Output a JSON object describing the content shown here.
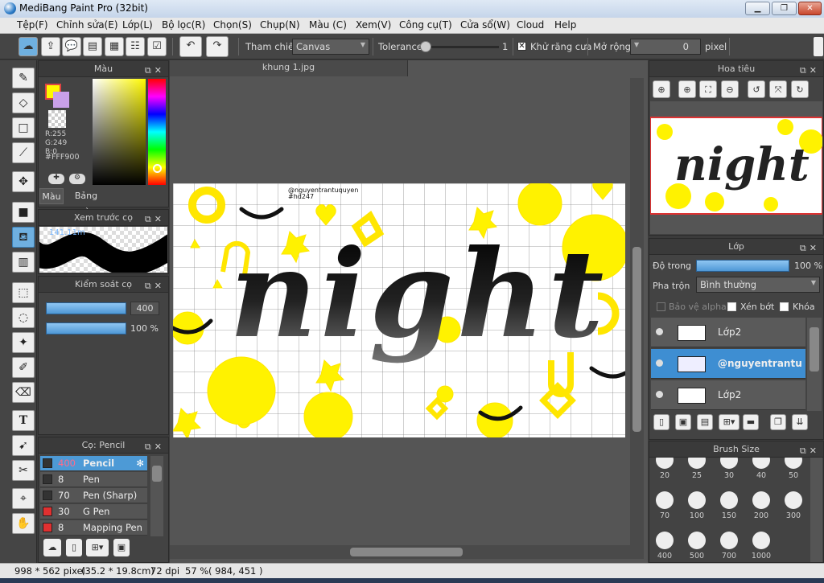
{
  "window": {
    "title": "MediBang Paint Pro (32bit)",
    "min": "▁",
    "max": "❐",
    "close": "✕"
  },
  "menu": [
    "Tệp(F)",
    "Chỉnh sửa(E)",
    "Lớp(L)",
    "Bộ lọc(R)",
    "Chọn(S)",
    "Chụp(N)",
    "Màu (C)",
    "Xem(V)",
    "Công cụ(T)",
    "Cửa sổ(W)",
    "Cloud",
    "Help"
  ],
  "toolbar": {
    "reference_label": "Tham chiếu",
    "reference_value": "Canvas",
    "tolerance_label": "Tolerance",
    "tolerance_value": "1",
    "antialias_label": "Khử răng cưa",
    "antialias_checked": true,
    "expand_label": "Mở rộng",
    "expand_value": "0",
    "expand_unit": "pixel"
  },
  "color_panel": {
    "title": "Màu",
    "r": "R:255",
    "g": "G:249",
    "b": "B:0",
    "hex": "#FFF900",
    "primary": "#FFF900",
    "tab_color": "Màu",
    "tab_palette": "Bảng màu"
  },
  "brush_preview": {
    "title": "Xem trước cọ",
    "size": "141.11m"
  },
  "brush_control": {
    "title": "Kiểm soát cọ",
    "size": "400",
    "opacity": "100 %"
  },
  "brush_list": {
    "title": "Cọ: Pencil",
    "items": [
      {
        "size": "400",
        "name": "Pencil",
        "color": "#333333",
        "selected": true
      },
      {
        "size": "8",
        "name": "Pen",
        "color": "#333333"
      },
      {
        "size": "70",
        "name": "Pen (Sharp)",
        "color": "#333333"
      },
      {
        "size": "30",
        "name": "G Pen",
        "color": "#e03030"
      },
      {
        "size": "8",
        "name": "Mapping Pen",
        "color": "#e03030"
      }
    ]
  },
  "document": {
    "tab": "khung 1.jpg",
    "credit_line1": "@nguyentrantuquyen",
    "credit_line2": "#hd247",
    "title_art": "night"
  },
  "navigator": {
    "title": "Hoa tiêu"
  },
  "layer_panel": {
    "title": "Lớp",
    "opacity_label": "Độ trong",
    "opacity_value": "100 %",
    "opacity_fraction": 1.0,
    "blend_label": "Pha trộn",
    "blend_value": "Bình thường",
    "protect_alpha": "Bảo vệ alpha",
    "clipping": "Xén bớt",
    "lock": "Khóa",
    "layers": [
      {
        "name": "Lớp2",
        "selected": false
      },
      {
        "name": "@nguyentrantuquyen",
        "selected": true
      },
      {
        "name": "Lớp2",
        "selected": false
      }
    ]
  },
  "brush_size": {
    "title": "Brush Size",
    "sizes": [
      "20",
      "25",
      "30",
      "40",
      "50",
      "70",
      "100",
      "150",
      "200",
      "300",
      "400",
      "500",
      "700",
      "1000"
    ]
  },
  "status": {
    "dimensions": "998 * 562 pixel",
    "physical": "(35.2 * 19.8cm)",
    "dpi": "72 dpi",
    "zoom": "57 %",
    "cursor": "( 984, 451 )"
  }
}
